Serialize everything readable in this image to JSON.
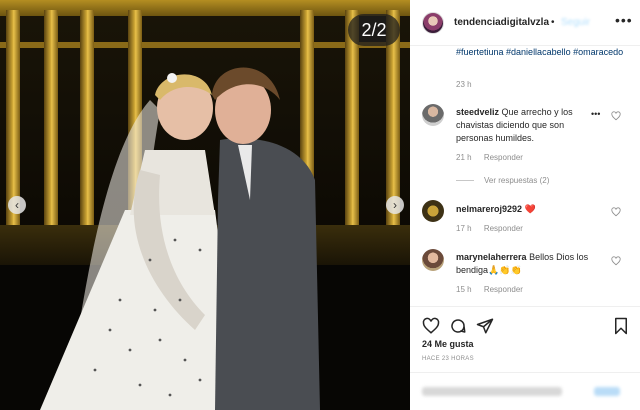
{
  "post": {
    "image_counter": "2/2",
    "username": "tendenciadigitalvzla",
    "dot": "•",
    "caption_tags": "#fuertetiuna #daniellacabello #omaracedo",
    "caption_time": "23 h",
    "likes": "24 Me gusta",
    "posted_time": "HACE 23 HORAS"
  },
  "comments": [
    {
      "user": "steedveliz",
      "text": "Que arrecho y los chavistas diciendo que son personas humildes.",
      "time": "21 h",
      "reply_label": "Responder",
      "view_replies": "Ver respuestas (2)"
    },
    {
      "user": "nelmareroj9292",
      "text": "❤️",
      "time": "17 h",
      "reply_label": "Responder"
    },
    {
      "user": "marynelaherrera",
      "text": "Bellos Dios los bendiga🙏👏👏",
      "time": "15 h",
      "reply_label": "Responder"
    }
  ],
  "icons": {
    "header_more": "more-horizontal-icon",
    "comment_more": "more-horizontal-icon",
    "like": "heart-outline-icon",
    "comment": "comment-bubble-icon",
    "share": "paper-plane-icon",
    "save": "bookmark-icon",
    "prev": "chevron-left-icon",
    "next": "chevron-right-icon"
  },
  "colors": {
    "link": "#00376b",
    "muted": "#8e8e8e",
    "text": "#262626",
    "heart_red": "#ed4956"
  }
}
